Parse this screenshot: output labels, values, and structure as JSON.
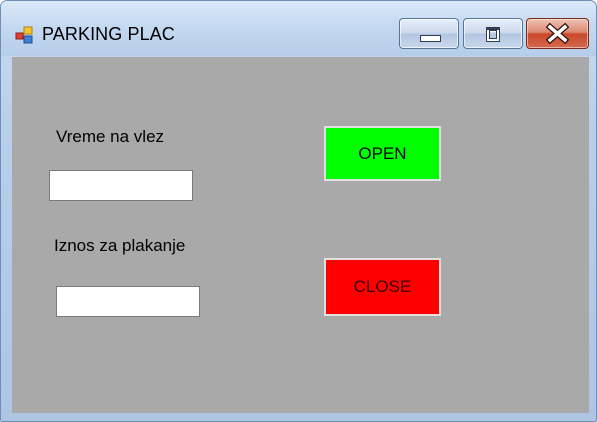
{
  "window": {
    "title": "PARKING PLAC"
  },
  "form": {
    "entry_time_label": "Vreme na vlez",
    "entry_time_value": "",
    "amount_label": "Iznos za plakanje",
    "amount_value": "",
    "open_label": "OPEN",
    "close_label": "CLOSE"
  },
  "colors": {
    "client_background": "#a9a9a9",
    "open_button": "#00ff00",
    "close_button": "#ff0000"
  },
  "icons": {
    "app": "app-icon",
    "minimize": "minimize-icon",
    "maximize": "maximize-icon",
    "close": "close-icon"
  }
}
